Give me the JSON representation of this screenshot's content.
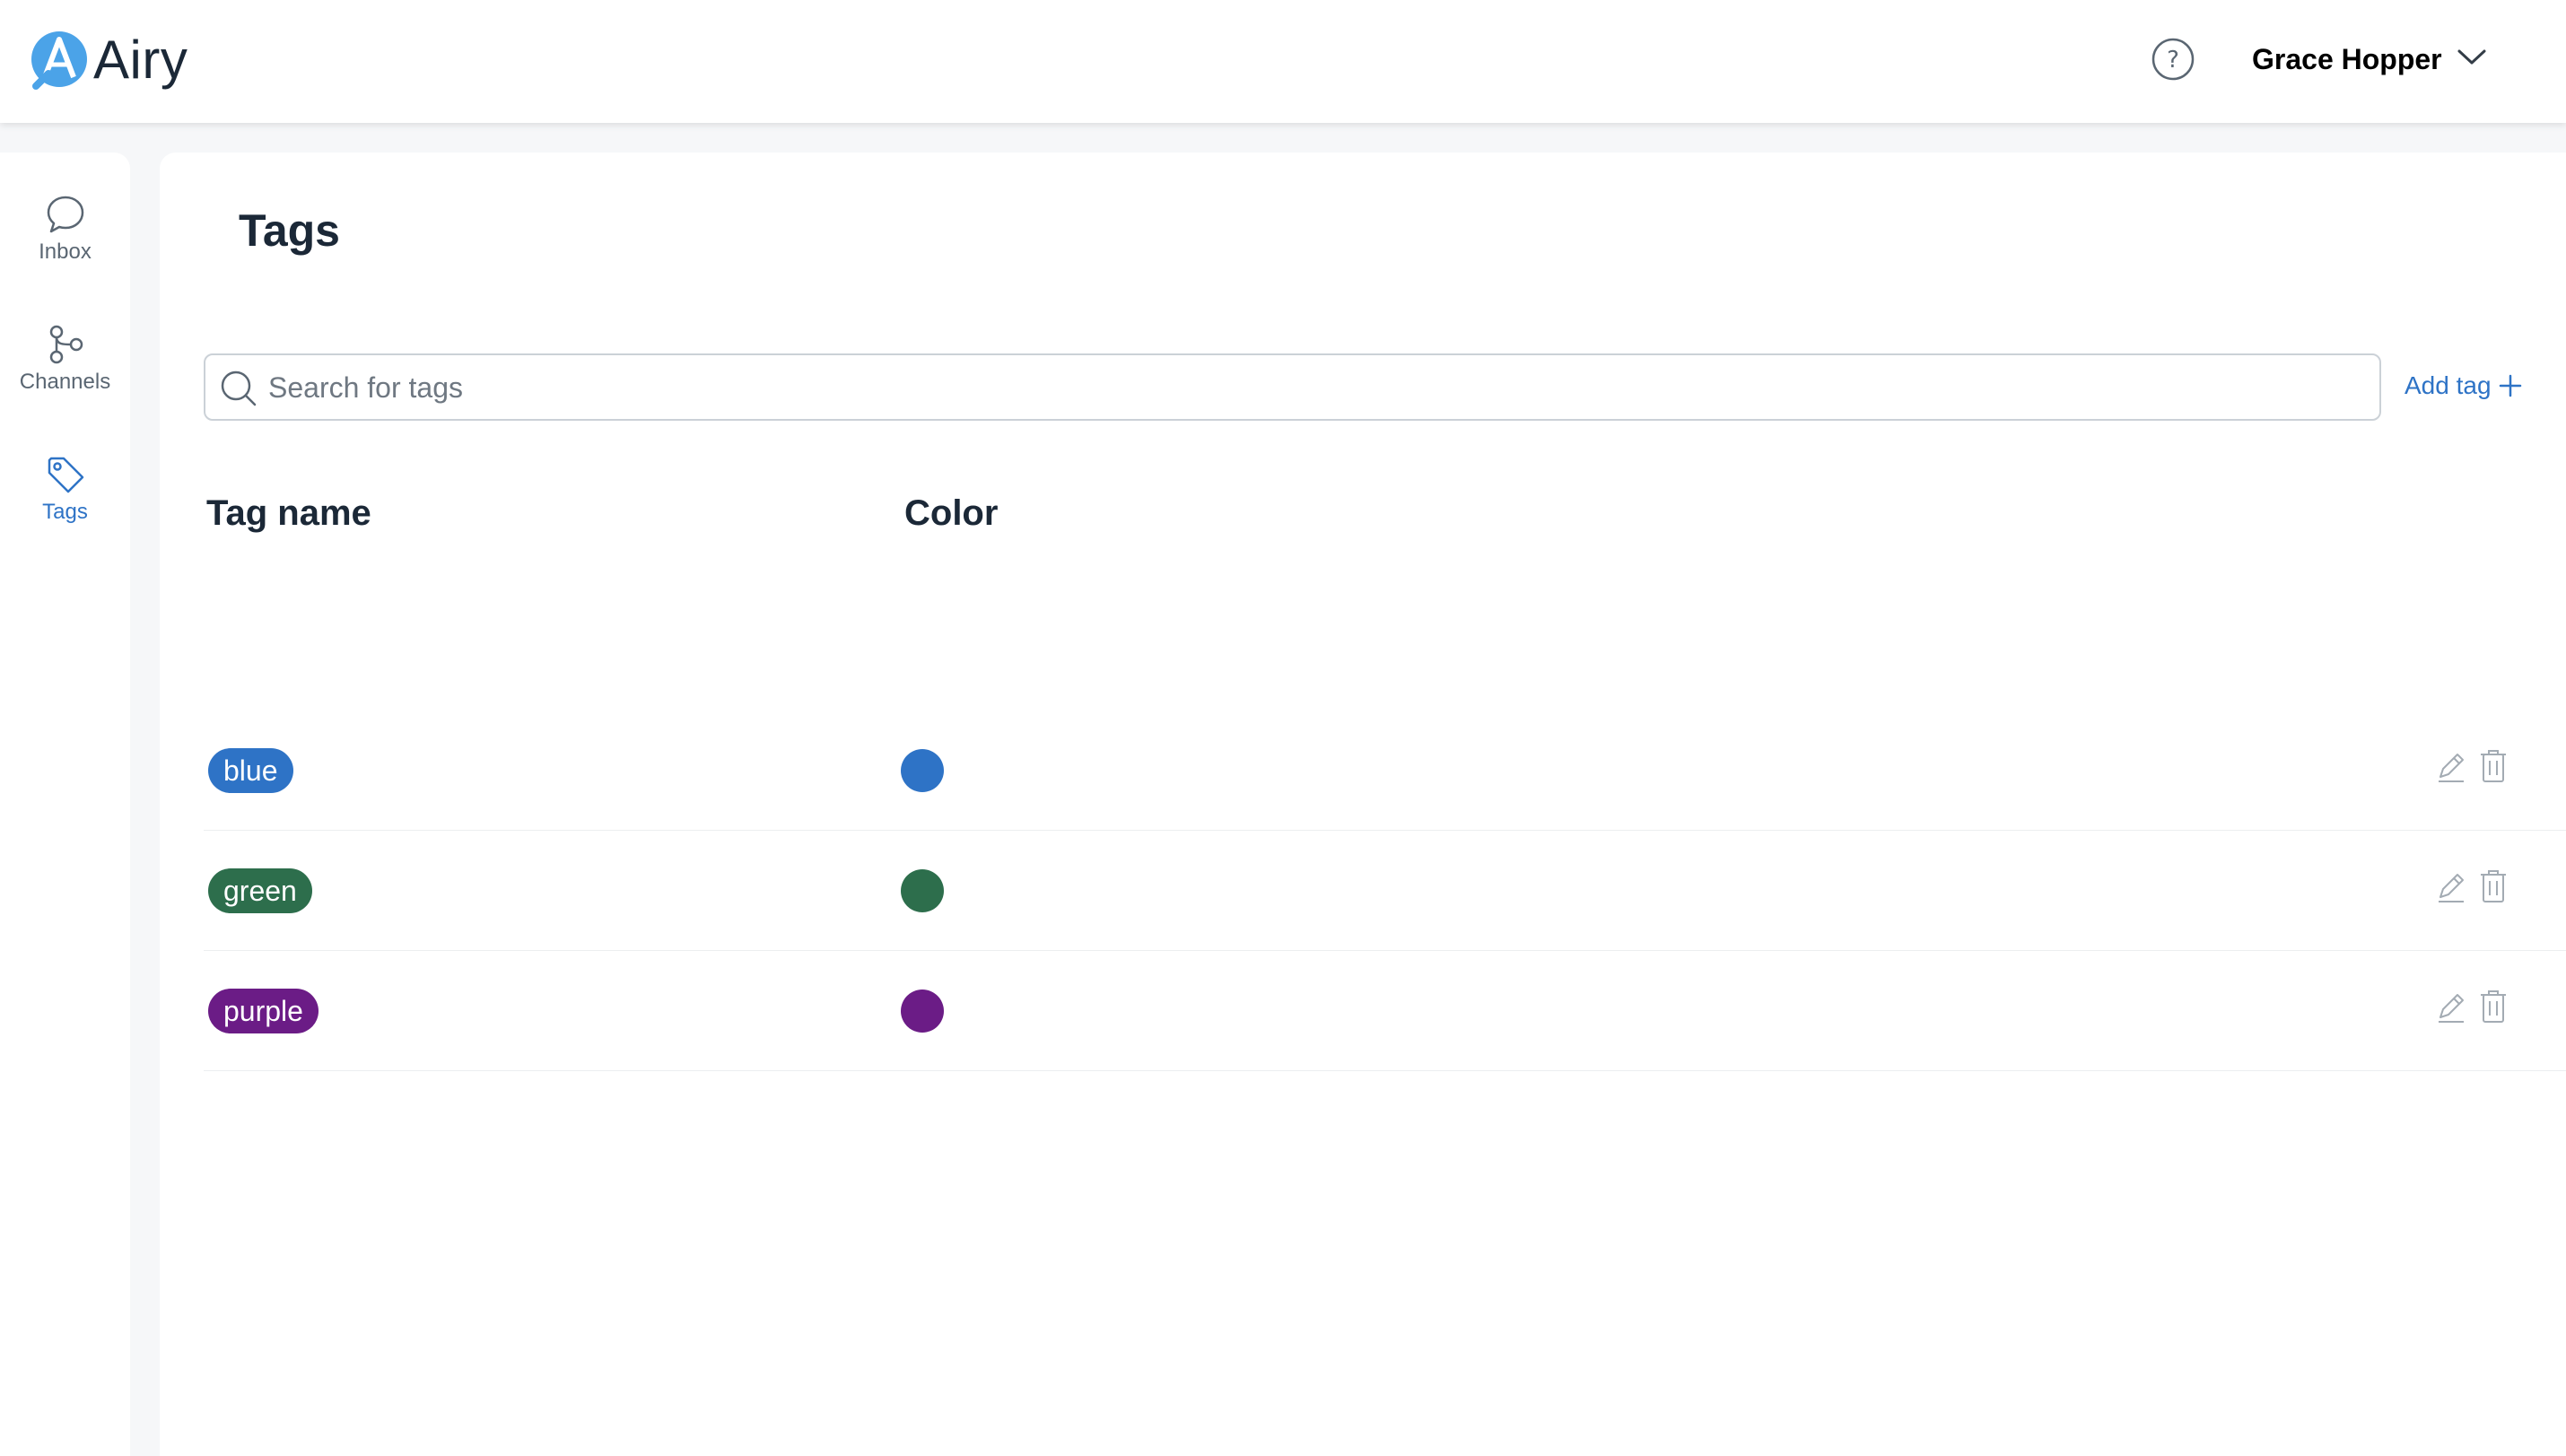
{
  "app": {
    "logo_text": "Airy",
    "accent_color": "#2e73c6"
  },
  "header": {
    "help_icon": "help-circle-icon",
    "user_name": "Grace Hopper",
    "user_menu_icon": "chevron-down-icon"
  },
  "sidebar": {
    "items": [
      {
        "label": "Inbox",
        "icon": "chat-bubble-icon",
        "active": false
      },
      {
        "label": "Channels",
        "icon": "channels-icon",
        "active": false
      },
      {
        "label": "Tags",
        "icon": "tag-icon",
        "active": true
      }
    ]
  },
  "page": {
    "title": "Tags",
    "search": {
      "placeholder": "Search for tags",
      "value": ""
    },
    "add_tag_label": "Add tag",
    "columns": [
      "Tag name",
      "Color"
    ],
    "tags": [
      {
        "name": "blue",
        "color": "#2e73c6"
      },
      {
        "name": "green",
        "color": "#2d6e4c"
      },
      {
        "name": "purple",
        "color": "#6b1c86"
      }
    ]
  }
}
